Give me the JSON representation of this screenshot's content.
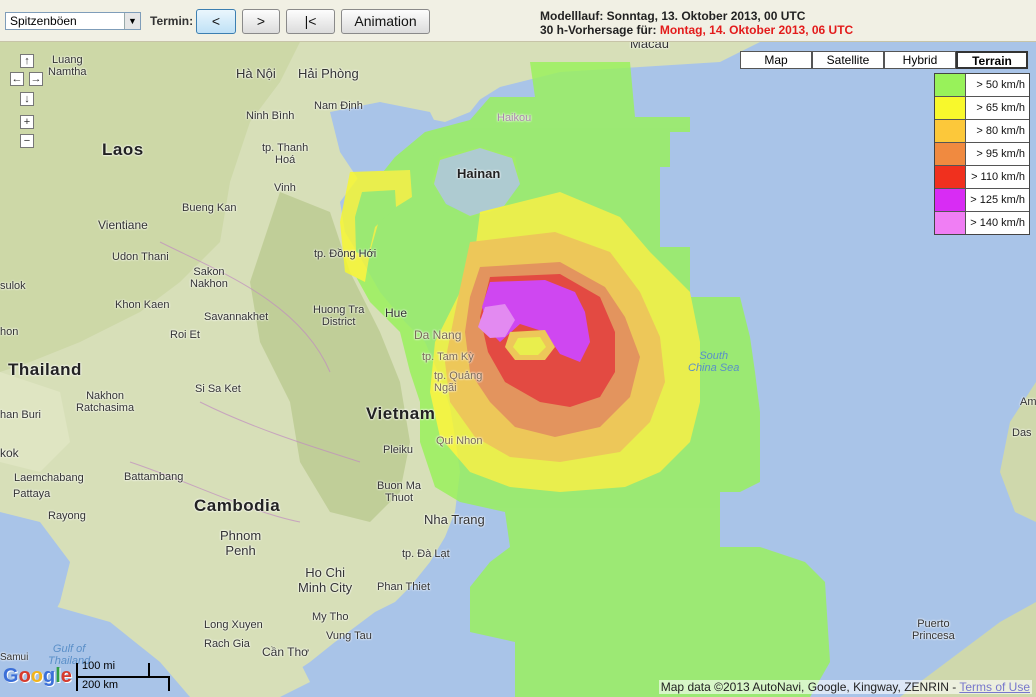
{
  "toolbar": {
    "parameter_select": "Spitzenböen",
    "termin_label": "Termin:",
    "prev_label": "<",
    "next_label": ">",
    "first_label": "|<",
    "animation_label": "Animation",
    "modelllauf_label": "Modelllauf:",
    "modelllauf_value": "Sonntag, 13. Oktober 2013, 00 UTC",
    "forecast_label": "30 h-Vorhersage für:",
    "forecast_value": "Montag, 14. Oktober 2013, 06 UTC"
  },
  "map_types": [
    "Map",
    "Satellite",
    "Hybrid",
    "Terrain"
  ],
  "map_type_selected": "Terrain",
  "nav_controls": {
    "up": "↑",
    "left": "←",
    "right": "→",
    "down": "↓",
    "zoom_in": "+",
    "zoom_out": "−"
  },
  "legend": [
    {
      "label": "> 50 km/h",
      "color": "#98f25a"
    },
    {
      "label": "> 65 km/h",
      "color": "#f8f82c"
    },
    {
      "label": "> 80 km/h",
      "color": "#fcc83a"
    },
    {
      "label": "> 95 km/h",
      "color": "#f08a40"
    },
    {
      "label": "> 110 km/h",
      "color": "#f0301e"
    },
    {
      "label": "> 125 km/h",
      "color": "#d82cf4"
    },
    {
      "label": "> 140 km/h",
      "color": "#f07ef4"
    }
  ],
  "places": {
    "luang_namtha": "Luang\nNamtha",
    "ha_noi": "Hà Nội",
    "hai_phong": "Hải Phòng",
    "nam_dinh": "Nam Định",
    "ninh_binh": "Ninh Bình",
    "laos": "Laos",
    "thanh_hoa": "tp. Thanh\nHoá",
    "vinh": "Vinh",
    "vientiane": "Vientiane",
    "bueng_kan": "Bueng Kan",
    "udon_thani": "Udon Thani",
    "sakon_nakhon": "Sakon\nNakhon",
    "dong_hoi": "tp. Đồng Hới",
    "sulok": "sulok",
    "khon_kaen": "Khon Kaen",
    "savannakhet": "Savannakhet",
    "roi_et": "Roi Et",
    "hue": "Hue",
    "huong_tra": "Huong Tra\nDistrict",
    "da_nang": "Da Nang",
    "tam_ky": "tp. Tam Kỳ",
    "quang_ngai": "tp. Quảng\nNgãi",
    "thailand": "Thailand",
    "nakhon_ratchasima": "Nakhon\nRatchasima",
    "si_sa_ket": "Si Sa Ket",
    "han_buri": "han Buri",
    "vietnam": "Vietnam",
    "qui_nhon": "Qui Nhon",
    "pleiku": "Pleiku",
    "kok": "kok",
    "spitzenbirne": "Laemchabang",
    "battambang": "Battambang",
    "pattaya": "Pattaya",
    "cambodia": "Cambodia",
    "buon_ma_thuot": "Buon Ma\nThuot",
    "rayong": "Rayong",
    "nha_trang": "Nha Trang",
    "phnom_penh": "Phnom\nPenh",
    "da_lat": "tp. Đà Lạt",
    "ho_chi_minh": "Ho Chi\nMinh City",
    "phan_thiet": "Phan Thiet",
    "my_tho": "My Tho",
    "long_xuyen": "Long Xuyen",
    "rach_gia": "Rach Gia",
    "vung_tau": "Vung Tau",
    "can_tho": "Cần Thơ",
    "gulf_of_thailand": "Gulf of\nThailand",
    "hainan": "Hainan",
    "haikou": "Haikou",
    "macau": "Macau",
    "south_china_sea": "South\nChina Sea",
    "puerto_princesa": "Puerto\nPrincesa",
    "das": "Das",
    "am": "Am",
    "hon": "hon",
    "samui": "Samui"
  },
  "scale": {
    "miles": "100 mi",
    "km": "200 km"
  },
  "google_logo": "Google",
  "copyright": "Map data ©2013 AutoNavi, Google, Kingway, ZENRIN - ",
  "terms_link": "Terms of Use"
}
